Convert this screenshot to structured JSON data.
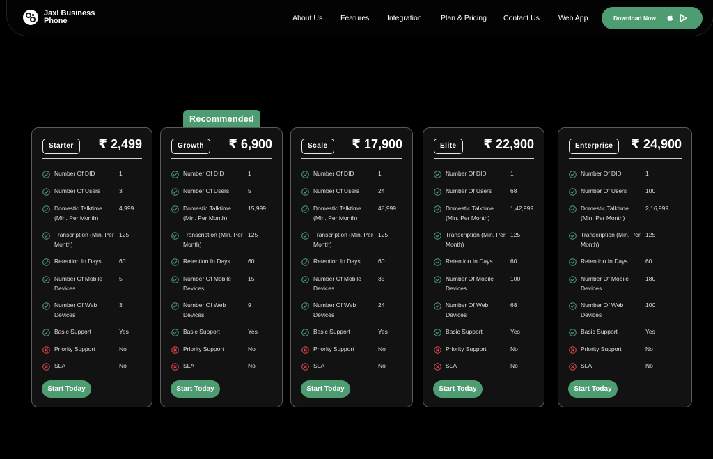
{
  "brand": {
    "name": "Jaxl Business Phone"
  },
  "nav": {
    "links": [
      "About Us",
      "Features",
      "Integration",
      "Plan & Pricing",
      "Contact Us",
      "Web App"
    ],
    "download_label": "Download Now"
  },
  "icons": {
    "logo": "jaxl-logo-icon",
    "apple": "apple-icon",
    "play": "google-play-icon",
    "check": "check-circle-icon",
    "cross": "x-circle-icon"
  },
  "colors": {
    "accent": "#4e9c72",
    "check": "#4e9c72",
    "cross": "#e2464d",
    "background": "#000000",
    "card": "#121212"
  },
  "pricing": {
    "recommended_label": "Recommended",
    "feature_labels": [
      "Number Of DID",
      "Number Of Users",
      "Domestic Talktime (Min. Per Month)",
      "Transcription (Min. Per Month)",
      "Retention In Days",
      "Number Of Mobile Devices",
      "Number Of Web Devices",
      "Basic Support",
      "Priority Support",
      "SLA"
    ],
    "plans": [
      {
        "name": "Starter",
        "price": "₹ 2,499",
        "cta": "Start Today",
        "values": [
          "1",
          "3",
          "4,999",
          "125",
          "60",
          "5",
          "3",
          "Yes",
          "No",
          "No"
        ],
        "included": [
          true,
          true,
          true,
          true,
          true,
          true,
          true,
          true,
          false,
          false
        ]
      },
      {
        "name": "Growth",
        "price": "₹ 6,900",
        "cta": "Start Today",
        "values": [
          "1",
          "5",
          "15,999",
          "125",
          "60",
          "15",
          "9",
          "Yes",
          "No",
          "No"
        ],
        "included": [
          true,
          true,
          true,
          true,
          true,
          true,
          true,
          true,
          false,
          false
        ]
      },
      {
        "name": "Scale",
        "price": "₹ 17,900",
        "cta": "Start Today",
        "values": [
          "1",
          "24",
          "48,999",
          "125",
          "60",
          "35",
          "24",
          "Yes",
          "No",
          "No"
        ],
        "included": [
          true,
          true,
          true,
          true,
          true,
          true,
          true,
          true,
          false,
          false
        ]
      },
      {
        "name": "Elite",
        "price": "₹ 22,900",
        "cta": "Start Today",
        "values": [
          "1",
          "68",
          "1,42,999",
          "125",
          "60",
          "100",
          "68",
          "Yes",
          "No",
          "No"
        ],
        "included": [
          true,
          true,
          true,
          true,
          true,
          true,
          true,
          true,
          false,
          false
        ]
      },
      {
        "name": "Enterprise",
        "price": "₹ 24,900",
        "cta": "Start Today",
        "values": [
          "1",
          "100",
          "2,16,999",
          "125",
          "60",
          "180",
          "100",
          "Yes",
          "No",
          "No"
        ],
        "included": [
          true,
          true,
          true,
          true,
          true,
          true,
          true,
          true,
          false,
          false
        ]
      }
    ]
  }
}
